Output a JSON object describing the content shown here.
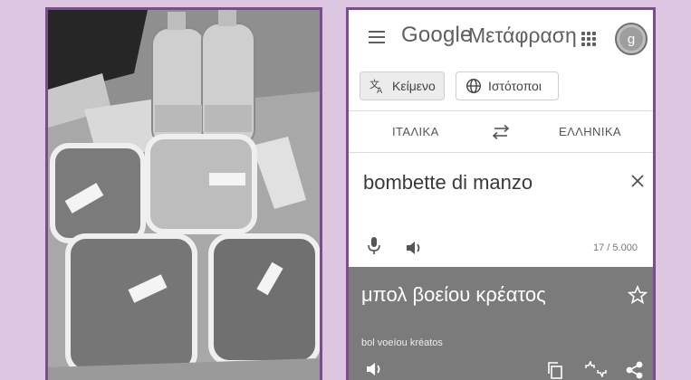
{
  "photo": {
    "description_icon": "food-containers-photo"
  },
  "app": {
    "logo_prefix": "Google",
    "logo_word": "Μετάφραση",
    "avatar_letter": "g",
    "icons": {
      "menu": "menu-icon",
      "apps": "apps-grid-icon"
    }
  },
  "modes": [
    {
      "label": "Κείμενο",
      "icon": "translate-text-icon",
      "selected": true
    },
    {
      "label": "Ιστότοποι",
      "icon": "globe-icon",
      "selected": false
    }
  ],
  "languages": {
    "source": "ΙΤΑΛΙΚΑ",
    "target": "ΕΛΛΗΝΙΚΑ",
    "swap_icon": "swap-arrows-icon"
  },
  "input": {
    "text": "bombette di manzo",
    "char_count": "17 / 5.000",
    "icons": {
      "clear": "close-icon",
      "mic": "microphone-icon",
      "speaker": "speaker-icon"
    }
  },
  "output": {
    "text": "μπολ βοείου κρέατος",
    "transliteration": "bol voeíou kréatos",
    "icons": {
      "star": "star-icon",
      "speaker": "speaker-icon",
      "copy": "copy-icon",
      "feedback": "feedback-icon",
      "share": "share-icon"
    }
  },
  "colors": {
    "frame": "#7d4c8e",
    "background": "#dcc6e2",
    "result_panel": "#7b7b7b"
  }
}
